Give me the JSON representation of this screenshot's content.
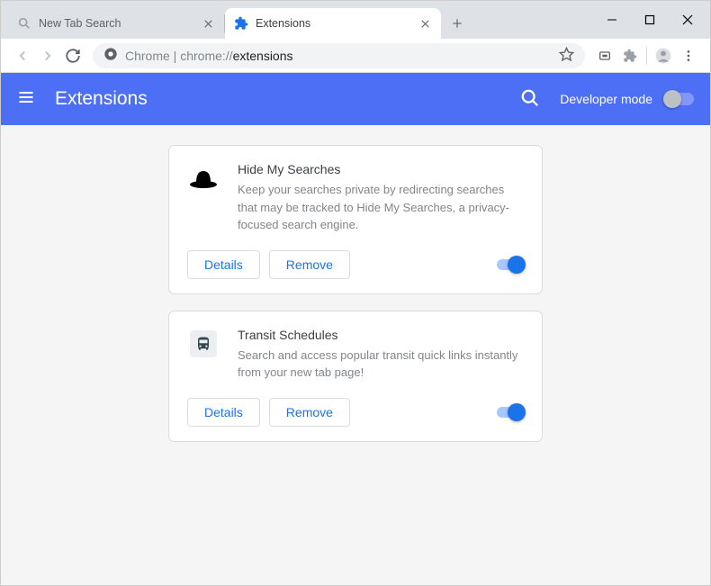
{
  "tabs": [
    {
      "title": "New Tab Search",
      "active": false
    },
    {
      "title": "Extensions",
      "active": true
    }
  ],
  "omnibox": {
    "label": "Chrome",
    "url_dim": "chrome://",
    "url_bold": "extensions"
  },
  "header": {
    "title": "Extensions",
    "dev_mode_label": "Developer mode"
  },
  "extensions": [
    {
      "name": "Hide My Searches",
      "description": "Keep your searches private by redirecting searches that may be tracked to Hide My Searches, a privacy-focused search engine.",
      "details_label": "Details",
      "remove_label": "Remove",
      "enabled": true,
      "icon": "hat"
    },
    {
      "name": "Transit Schedules",
      "description": "Search and access popular transit quick links instantly from your new tab page!",
      "details_label": "Details",
      "remove_label": "Remove",
      "enabled": true,
      "icon": "bus"
    }
  ]
}
